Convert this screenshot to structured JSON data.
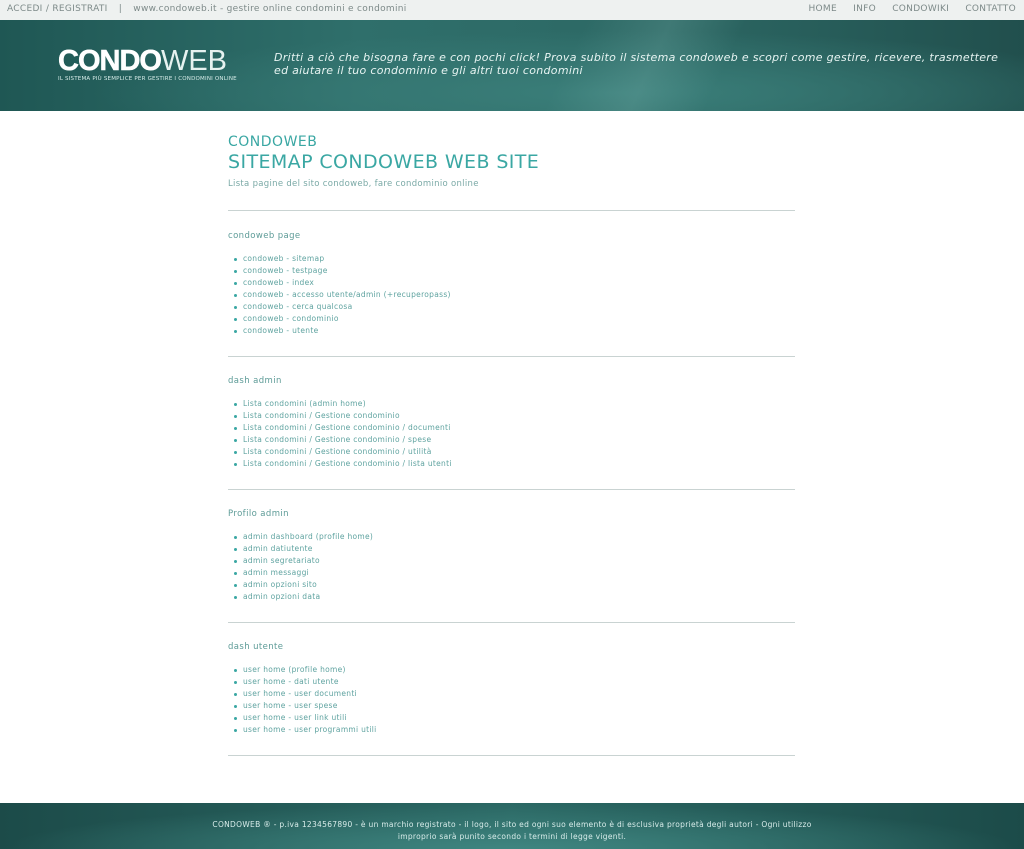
{
  "topbar": {
    "login": "ACCEDI",
    "slash": "/",
    "register": "REGISTRATI",
    "separator": "|",
    "site_text": "www.condoweb.it - gestire online condomini e condomini",
    "nav": [
      "HOME",
      "INFO",
      "CONDOWIKI",
      "CONTATTO"
    ]
  },
  "hero": {
    "logo_condo": "CONDO",
    "logo_web": "WEB",
    "logo_tagline": "IL SISTEMA PIÙ SEMPLICE PER GESTIRE I CONDOMINI ONLINE",
    "pitch": "Dritti a ciò che bisogna fare e con pochi click! Prova subito il sistema condoweb e scopri come gestire, ricevere, trasmettere ed aiutare il tuo condominio e gli altri tuoi condomini"
  },
  "page": {
    "brand": "CONDOWEB",
    "title": "SITEMAP CONDOWEB WEB SITE",
    "subtitle": "Lista pagine del sito condoweb, fare condominio online"
  },
  "sections": [
    {
      "title": "condoweb page",
      "items": [
        "condoweb - sitemap",
        "condoweb - testpage",
        "condoweb - index",
        "condoweb - accesso utente/admin (+recuperopass)",
        "condoweb - cerca qualcosa",
        "condoweb - condominio",
        "condoweb - utente"
      ]
    },
    {
      "title": "dash admin",
      "items": [
        "Lista condomini (admin home)",
        "Lista condomini / Gestione condominio",
        "Lista condomini / Gestione condominio / documenti",
        "Lista condomini / Gestione condominio / spese",
        "Lista condomini / Gestione condominio / utilità",
        "Lista condomini / Gestione condominio / lista utenti"
      ]
    },
    {
      "title": "Profilo admin",
      "items": [
        "admin dashboard (profile home)",
        "admin datiutente",
        "admin segretariato",
        "admin messaggi",
        "admin opzioni sito",
        "admin opzioni data"
      ]
    },
    {
      "title": "dash utente",
      "items": [
        "user home (profile home)",
        "user home - dati utente",
        "user home - user documenti",
        "user home - user spese",
        "user home - user link utili",
        "user home - user programmi utili"
      ]
    }
  ],
  "footer": {
    "line1": "CONDOWEB ® - p.iva 1234567890 - è un marchio registrato - il logo, il sito ed ogni suo elemento è di esclusiva proprietà degli autori - Ogni utilizzo",
    "line2": "improprio sarà punito secondo i termini di legge vigenti."
  }
}
